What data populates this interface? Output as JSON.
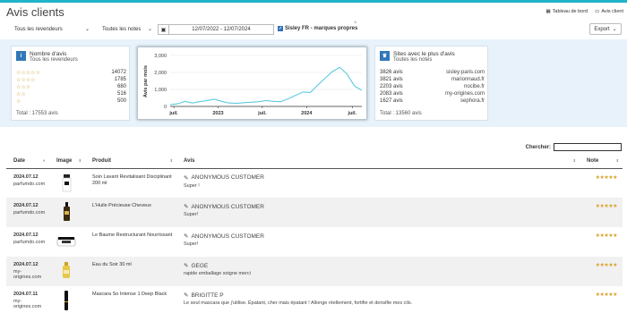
{
  "page": {
    "title": "Avis clients"
  },
  "breadcrumb": {
    "home": "Tableau de bord",
    "current": "Avis client"
  },
  "filters": {
    "revendeurs": "Tous les revendeurs",
    "notes": "Toutes les notes",
    "date_range": "12/07/2022 - 12/07/2024",
    "brand_check": "Sisley FR - marques propres",
    "export": "Export"
  },
  "reviews_count": {
    "title": "Nombre d'avis",
    "subtitle": "Tous les revendeurs",
    "rows": [
      {
        "stars": "☆☆☆☆☆",
        "count": "14072"
      },
      {
        "stars": "☆☆☆☆",
        "count": "1785"
      },
      {
        "stars": "☆☆☆",
        "count": "680"
      },
      {
        "stars": "☆☆",
        "count": "516"
      },
      {
        "stars": "☆",
        "count": "500"
      }
    ],
    "total": "Total : 17553 avis"
  },
  "sites": {
    "title": "Sites avec le plus d'avis",
    "subtitle": "Toutes les notes",
    "rows": [
      {
        "count": "3826 avis",
        "name": "sisley-paris.com"
      },
      {
        "count": "3821 avis",
        "name": "marionnaud.fr"
      },
      {
        "count": "2203 avis",
        "name": "nocibe.fr"
      },
      {
        "count": "2083 avis",
        "name": "my-origines.com"
      },
      {
        "count": "1627 avis",
        "name": "sephora.fr"
      }
    ],
    "total": "Total : 13560 avis"
  },
  "chart_data": {
    "type": "line",
    "ylabel": "Avis par mois",
    "ylim": [
      0,
      3000
    ],
    "yticks": [
      "0",
      "1,000",
      "2,000",
      "3,000"
    ],
    "xticks": [
      "juil.",
      "2023",
      "juil.",
      "2024",
      "juil."
    ],
    "x": [
      "2022-07",
      "2022-08",
      "2022-09",
      "2022-10",
      "2022-11",
      "2022-12",
      "2023-01",
      "2023-02",
      "2023-03",
      "2023-04",
      "2023-05",
      "2023-06",
      "2023-07",
      "2023-08",
      "2023-09",
      "2023-10",
      "2023-11",
      "2023-12",
      "2024-01",
      "2024-02",
      "2024-03",
      "2024-04",
      "2024-05",
      "2024-06",
      "2024-07"
    ],
    "values": [
      100,
      150,
      300,
      200,
      280,
      350,
      420,
      300,
      200,
      180,
      220,
      250,
      280,
      350,
      300,
      280,
      450,
      650,
      850,
      820,
      1250,
      1650,
      2050,
      2300,
      1900
    ],
    "values_tail": [
      1200,
      950
    ],
    "color": "#5ccbe0"
  },
  "table": {
    "search_label": "Chercher:",
    "headers": [
      "Date",
      "Image",
      "Produit",
      "Avis",
      "Note"
    ],
    "rows": [
      {
        "date": "2024.07.12",
        "site": "parfumdo.com",
        "product": "Soin Lavant Revitalisant Disciplinant 200 ml",
        "author": "ANONYMOUS CUSTOMER",
        "comment": "Super !",
        "stars": "★★★★★"
      },
      {
        "date": "2024.07.12",
        "site": "parfumdo.com",
        "product": "L'Huile Précieuse Cheveux",
        "author": "ANONYMOUS CUSTOMER",
        "comment": "Super!",
        "stars": "★★★★★"
      },
      {
        "date": "2024.07.12",
        "site": "parfumdo.com",
        "product": "Le Baume Restructurant Nourrissant",
        "author": "ANONYMOUS CUSTOMER",
        "comment": "Super!",
        "stars": "★★★★★"
      },
      {
        "date": "2024.07.12",
        "site": "my-origines.com",
        "product": "Eau du Soir 30 ml",
        "author": "GEGE",
        "comment": "rapide emballage soigne merci",
        "stars": "★★★★★"
      },
      {
        "date": "2024.07.11",
        "site": "my-origines.com",
        "product": "Mascara So Intense 1 Deep Black",
        "author": "BRIGITTE P",
        "comment": "Le seul mascara que j'utilise. Épatant, cher mais épatant ! Allonge réellement, fortifie et densifie mes cils.",
        "stars": "★★★★★"
      }
    ]
  }
}
